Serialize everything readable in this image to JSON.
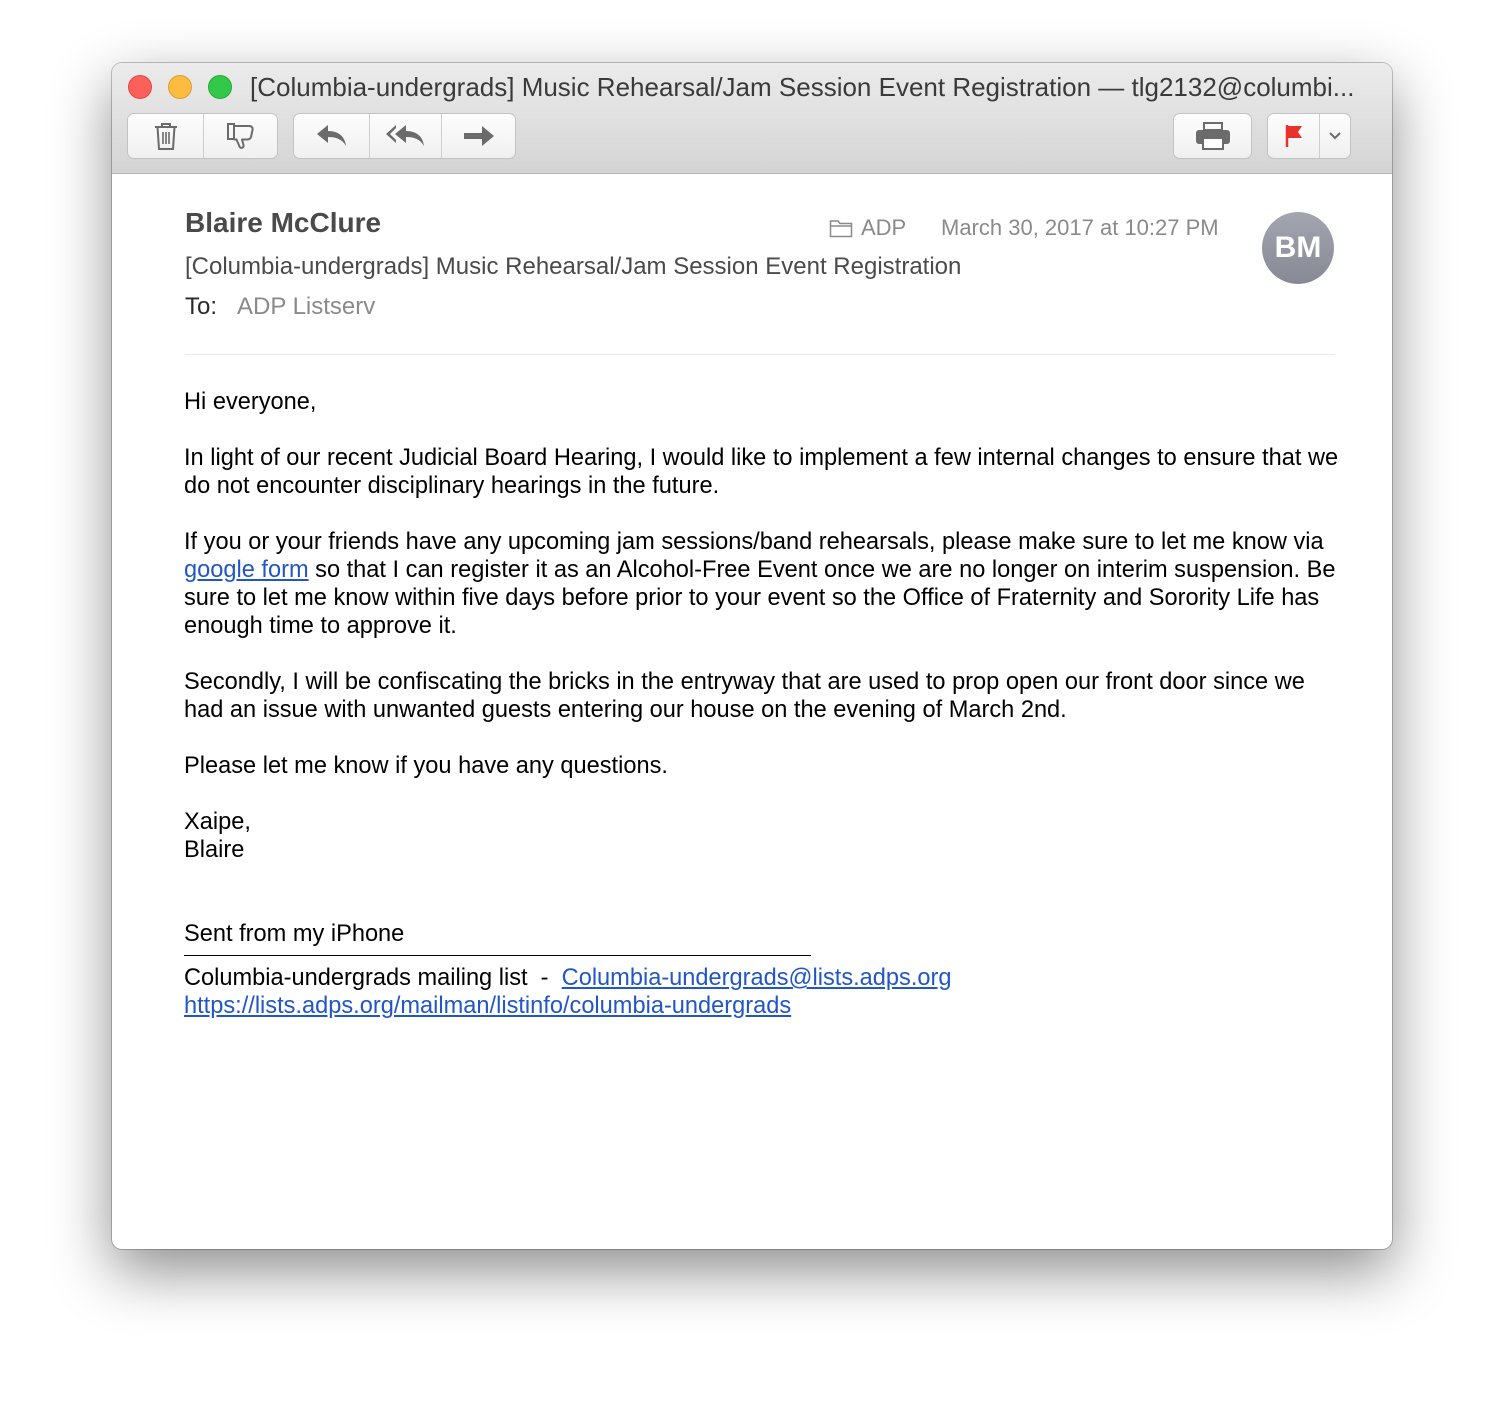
{
  "window": {
    "title": "[Columbia-undergrads] Music Rehearsal/Jam Session Event Registration — tlg2132@columbi..."
  },
  "toolbar": {
    "icons": [
      "trash-icon",
      "junk-icon",
      "reply-icon",
      "reply-all-icon",
      "forward-icon",
      "print-icon",
      "flag-icon",
      "chevron-down-icon"
    ],
    "flag_color": "#e8322c"
  },
  "message": {
    "sender": "Blaire McClure",
    "subject": "[Columbia-undergrads] Music Rehearsal/Jam Session Event Registration",
    "to_label": "To:",
    "to_value": "ADP Listserv",
    "mailbox": "ADP",
    "date": "March 30, 2017 at 10:27 PM",
    "avatar_initials": "BM"
  },
  "body": {
    "greeting": "Hi everyone,",
    "p1": "In light of our recent Judicial Board Hearing, I would like to implement a few internal changes to ensure that we do not encounter disciplinary hearings in the future.",
    "p2_before": "If you or your friends have any upcoming jam sessions/band rehearsals, please make sure to let me know via ",
    "p2_link": "google form",
    "p2_after": " so that I can register it as an Alcohol-Free Event once we are no longer on interim suspension. Be sure to let me know within five days before prior to your event so the Office of Fraternity and Sorority Life has enough time to approve it.",
    "p3": "Secondly, I will be confiscating the bricks in the entryway that are used to prop open our front door since we had an issue with unwanted guests entering our house on the evening of March 2nd.",
    "p4": "Please let me know if you have any questions.",
    "signoff": "Xaipe,",
    "signature": "Blaire",
    "sent_from": "Sent from my iPhone",
    "footer_label": "Columbia-undergrads mailing list  -  ",
    "footer_email": "Columbia-undergrads@lists.adps.org",
    "footer_url": "https://lists.adps.org/mailman/listinfo/columbia-undergrads"
  }
}
